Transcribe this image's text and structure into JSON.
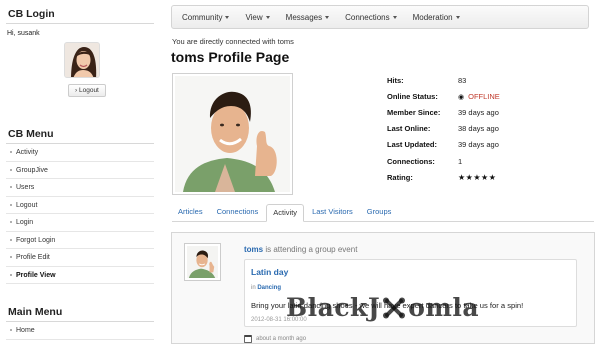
{
  "login": {
    "title": "CB Login",
    "greeting": "Hi, susank",
    "logout_label": "Logout"
  },
  "cb_menu": {
    "title": "CB Menu",
    "items": [
      {
        "label": "Activity"
      },
      {
        "label": "GroupJive"
      },
      {
        "label": "Users"
      },
      {
        "label": "Logout"
      },
      {
        "label": "Login"
      },
      {
        "label": "Forgot Login"
      },
      {
        "label": "Profile Edit"
      },
      {
        "label": "Profile View",
        "active": true
      }
    ]
  },
  "main_menu": {
    "title": "Main Menu",
    "items": [
      {
        "label": "Home"
      }
    ]
  },
  "navbar": {
    "items": [
      {
        "label": "Community"
      },
      {
        "label": "View"
      },
      {
        "label": "Messages"
      },
      {
        "label": "Connections"
      },
      {
        "label": "Moderation"
      }
    ]
  },
  "profile": {
    "connected_msg": "You are directly connected with toms",
    "title": "toms Profile Page",
    "fields": [
      {
        "label": "Hits:",
        "value": "83"
      },
      {
        "label": "Online Status:",
        "value": "OFFLINE"
      },
      {
        "label": "Member Since:",
        "value": "39 days ago"
      },
      {
        "label": "Last Online:",
        "value": "38 days ago"
      },
      {
        "label": "Last Updated:",
        "value": "39 days ago"
      },
      {
        "label": "Connections:",
        "value": "1"
      },
      {
        "label": "Rating:",
        "value": "★★★★★"
      }
    ]
  },
  "tabs": [
    {
      "label": "Articles"
    },
    {
      "label": "Connections"
    },
    {
      "label": "Activity",
      "active": true
    },
    {
      "label": "Last Visitors"
    },
    {
      "label": "Groups"
    }
  ],
  "activity": {
    "user": "toms",
    "action": "is attending a group event",
    "event_title": "Latin day",
    "category_prefix": "in",
    "category": "Dancing",
    "description": "Bring your latin dancing shoes - we will have expert dancers to take us for a spin!",
    "date": "2012-08-31 16:00:00",
    "timestamp": "about a month ago"
  },
  "watermark": "BlackJ",
  "watermark_tail": "omla",
  "colors": {
    "link": "#2a6ab0",
    "offline": "#c0392b"
  }
}
